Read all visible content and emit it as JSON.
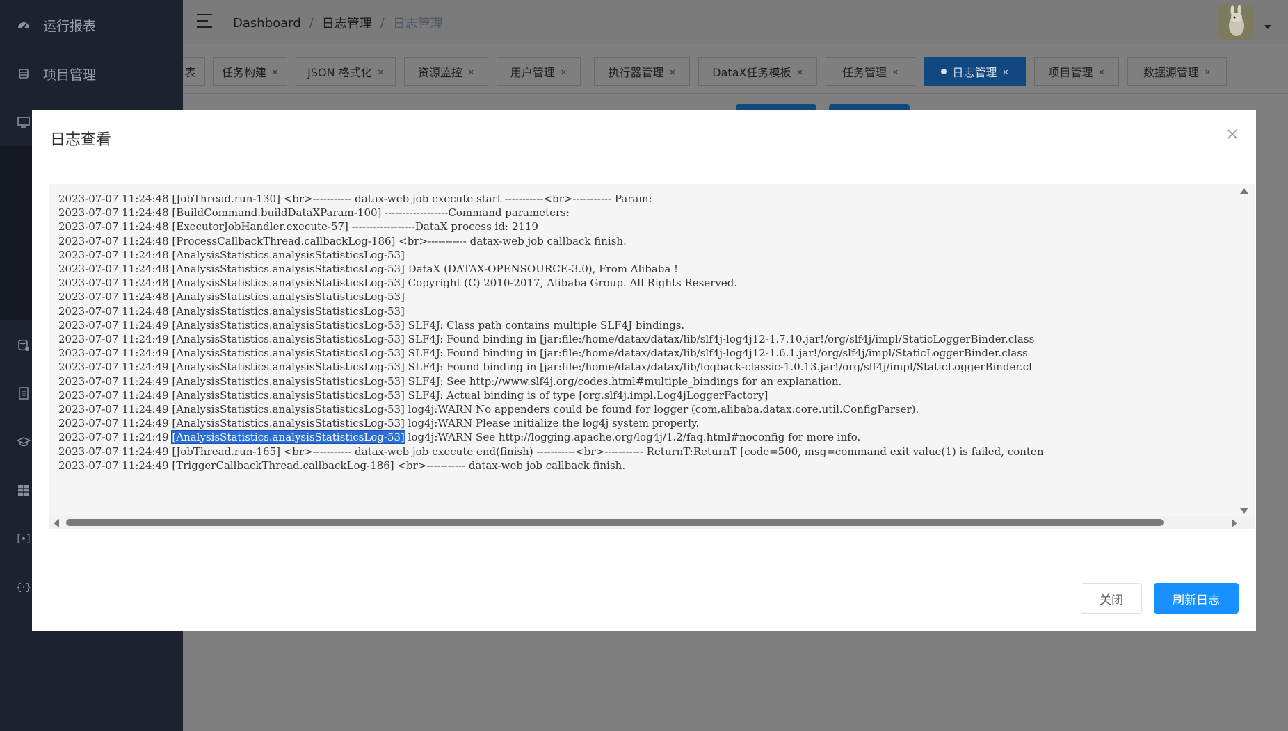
{
  "sidebar": {
    "items": [
      {
        "label": "运行报表",
        "icon": "dashboard-icon"
      },
      {
        "label": "项目管理",
        "icon": "database-icon"
      }
    ]
  },
  "header": {
    "breadcrumb": [
      "Dashboard",
      "日志管理",
      "日志管理"
    ]
  },
  "tags": [
    {
      "label": "表",
      "active": false
    },
    {
      "label": "任务构建",
      "active": false
    },
    {
      "label": "JSON 格式化",
      "active": false
    },
    {
      "label": "资源监控",
      "active": false
    },
    {
      "label": "用户管理",
      "active": false
    },
    {
      "label": "执行器管理",
      "active": false
    },
    {
      "label": "DataX任务模板",
      "active": false
    },
    {
      "label": "任务管理",
      "active": false
    },
    {
      "label": "日志管理",
      "active": true
    },
    {
      "label": "项目管理",
      "active": false
    },
    {
      "label": "数据源管理",
      "active": false
    }
  ],
  "tag_close_glyph": "×",
  "modal": {
    "title": "日志查看",
    "close_label": "关闭",
    "refresh_label": "刷新日志"
  },
  "log": {
    "lines": [
      "2023-07-07 11:24:48 [JobThread.run-130] <br>----------- datax-web job execute start -----------<br>----------- Param:",
      "2023-07-07 11:24:48 [BuildCommand.buildDataXParam-100] ------------------Command parameters:",
      "2023-07-07 11:24:48 [ExecutorJobHandler.execute-57] ------------------DataX process id: 2119",
      "2023-07-07 11:24:48 [ProcessCallbackThread.callbackLog-186] <br>----------- datax-web job callback finish.",
      "2023-07-07 11:24:48 [AnalysisStatistics.analysisStatisticsLog-53]",
      "2023-07-07 11:24:48 [AnalysisStatistics.analysisStatisticsLog-53] DataX (DATAX-OPENSOURCE-3.0), From Alibaba !",
      "2023-07-07 11:24:48 [AnalysisStatistics.analysisStatisticsLog-53] Copyright (C) 2010-2017, Alibaba Group. All Rights Reserved.",
      "2023-07-07 11:24:48 [AnalysisStatistics.analysisStatisticsLog-53]",
      "2023-07-07 11:24:48 [AnalysisStatistics.analysisStatisticsLog-53]",
      "2023-07-07 11:24:49 [AnalysisStatistics.analysisStatisticsLog-53] SLF4J: Class path contains multiple SLF4J bindings.",
      "2023-07-07 11:24:49 [AnalysisStatistics.analysisStatisticsLog-53] SLF4J: Found binding in [jar:file:/home/datax/datax/lib/slf4j-log4j12-1.7.10.jar!/org/slf4j/impl/StaticLoggerBinder.class",
      "2023-07-07 11:24:49 [AnalysisStatistics.analysisStatisticsLog-53] SLF4J: Found binding in [jar:file:/home/datax/datax/lib/slf4j-log4j12-1.6.1.jar!/org/slf4j/impl/StaticLoggerBinder.class",
      "2023-07-07 11:24:49 [AnalysisStatistics.analysisStatisticsLog-53] SLF4J: Found binding in [jar:file:/home/datax/datax/lib/logback-classic-1.0.13.jar!/org/slf4j/impl/StaticLoggerBinder.cl",
      "2023-07-07 11:24:49 [AnalysisStatistics.analysisStatisticsLog-53] SLF4J: See http://www.slf4j.org/codes.html#multiple_bindings for an explanation.",
      "2023-07-07 11:24:49 [AnalysisStatistics.analysisStatisticsLog-53] SLF4J: Actual binding is of type [org.slf4j.impl.Log4jLoggerFactory]",
      "2023-07-07 11:24:49 [AnalysisStatistics.analysisStatisticsLog-53] log4j:WARN No appenders could be found for logger (com.alibaba.datax.core.util.ConfigParser).",
      "2023-07-07 11:24:49 [AnalysisStatistics.analysisStatisticsLog-53] log4j:WARN Please initialize the log4j system properly.",
      "2023-07-07 11:24:49 [AnalysisStatistics.analysisStatisticsLog-53] log4j:WARN See http://logging.apache.org/log4j/1.2/faq.html#noconfig for more info.",
      "2023-07-07 11:24:49 [JobThread.run-165] <br>----------- datax-web job execute end(finish) -----------<br>----------- ReturnT:ReturnT [code=500, msg=command exit value(1) is failed, conten",
      "2023-07-07 11:24:49 [TriggerCallbackThread.callbackLog-186] <br>----------- datax-web job callback finish."
    ],
    "selected_line_index": 17,
    "selected_text": "[AnalysisStatistics.analysisStatisticsLog-53]"
  },
  "colors": {
    "primary": "#1890ff",
    "sidebar_bg": "#1c2230",
    "overlay": "#7f7f7f",
    "active_tag": "#11487f"
  }
}
